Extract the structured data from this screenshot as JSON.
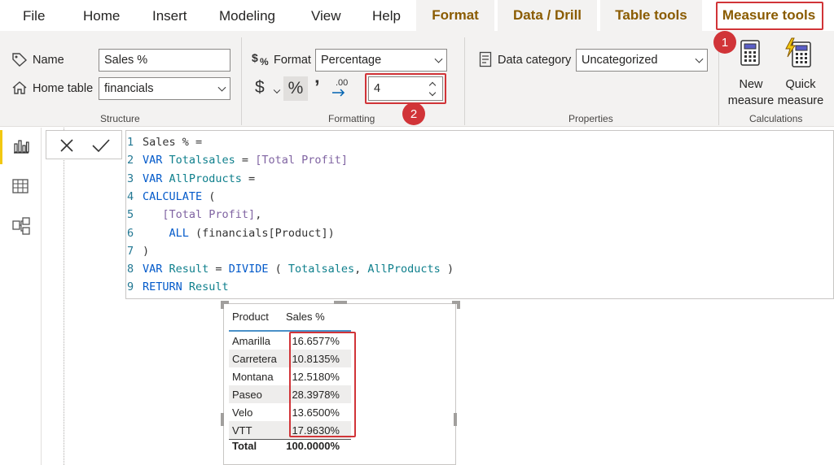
{
  "menu": {
    "file": "File",
    "home": "Home",
    "insert": "Insert",
    "modeling": "Modeling",
    "view": "View",
    "help": "Help",
    "format": "Format",
    "data_drill": "Data / Drill",
    "table_tools": "Table tools",
    "measure_tools": "Measure tools"
  },
  "structure": {
    "name_label": "Name",
    "name_value": "Sales %",
    "home_table_label": "Home table",
    "home_table_value": "financials",
    "group_label": "Structure"
  },
  "formatting": {
    "format_label": "Format",
    "format_value": "Percentage",
    "currency_symbol": "$",
    "percent_symbol": "%",
    "comma_symbol": "’",
    "decimal_symbol": ".00",
    "decimal_places": "4",
    "group_label": "Formatting"
  },
  "properties": {
    "data_category_label": "Data category",
    "data_category_value": "Uncategorized",
    "group_label": "Properties"
  },
  "calculations": {
    "new_measure": [
      "New",
      "measure"
    ],
    "quick_measure": [
      "Quick",
      "measure"
    ],
    "group_label": "Calculations"
  },
  "badges": {
    "one": "1",
    "two": "2"
  },
  "formula": {
    "lines": [
      {
        "n": "1",
        "parts": [
          {
            "t": "Sales % =",
            "c": "pl"
          }
        ]
      },
      {
        "n": "2",
        "parts": [
          {
            "t": "VAR ",
            "c": "kw"
          },
          {
            "t": "Totalsales",
            "c": "vr"
          },
          {
            "t": " = ",
            "c": "pl"
          },
          {
            "t": "[Total Profit]",
            "c": "ms"
          }
        ]
      },
      {
        "n": "3",
        "parts": [
          {
            "t": "VAR ",
            "c": "kw"
          },
          {
            "t": "AllProducts",
            "c": "vr"
          },
          {
            "t": " =",
            "c": "pl"
          }
        ]
      },
      {
        "n": "4",
        "parts": [
          {
            "t": "CALCULATE",
            "c": "kw"
          },
          {
            "t": " (",
            "c": "pl"
          }
        ]
      },
      {
        "n": "5",
        "parts": [
          {
            "t": "   ",
            "c": "pl"
          },
          {
            "t": "[Total Profit]",
            "c": "ms"
          },
          {
            "t": ",",
            "c": "pl"
          }
        ]
      },
      {
        "n": "6",
        "parts": [
          {
            "t": "    ",
            "c": "pl"
          },
          {
            "t": "ALL",
            "c": "kw"
          },
          {
            "t": " (",
            "c": "pl"
          },
          {
            "t": "financials[Product]",
            "c": "tb"
          },
          {
            "t": ")",
            "c": "pl"
          }
        ]
      },
      {
        "n": "7",
        "parts": [
          {
            "t": ")",
            "c": "pl"
          }
        ]
      },
      {
        "n": "8",
        "parts": [
          {
            "t": "VAR ",
            "c": "kw"
          },
          {
            "t": "Result",
            "c": "vr"
          },
          {
            "t": " = ",
            "c": "pl"
          },
          {
            "t": "DIVIDE",
            "c": "kw"
          },
          {
            "t": " ( ",
            "c": "pl"
          },
          {
            "t": "Totalsales",
            "c": "vr"
          },
          {
            "t": ", ",
            "c": "pl"
          },
          {
            "t": "AllProducts",
            "c": "vr"
          },
          {
            "t": " )",
            "c": "pl"
          }
        ]
      },
      {
        "n": "9",
        "parts": [
          {
            "t": "RETURN ",
            "c": "kw"
          },
          {
            "t": "Result",
            "c": "vr"
          }
        ]
      }
    ]
  },
  "table": {
    "headers": [
      "Product",
      "Sales %"
    ],
    "rows": [
      [
        "Amarilla",
        "16.6577%"
      ],
      [
        "Carretera",
        "10.8135%"
      ],
      [
        "Montana",
        "12.5180%"
      ],
      [
        "Paseo",
        "28.3978%"
      ],
      [
        "Velo",
        "13.6500%"
      ],
      [
        "VTT",
        "17.9630%"
      ]
    ],
    "total": [
      "Total",
      "100.0000%"
    ]
  },
  "colors": {
    "accent_yellow": "#f2c811",
    "context_tab_text": "#8a5b00",
    "highlight_red": "#d13438",
    "keyword_blue": "#035aca",
    "variable_teal": "#0e7f8c",
    "measure_purple": "#8064a2"
  },
  "icons": {
    "name": "tag-icon",
    "home_table": "home-icon",
    "format": "dollar-percent-icon",
    "data_category": "data-category-icon",
    "new_measure": "calculator-icon",
    "quick_measure": "lightning-calculator-icon",
    "report_view": "bar-chart-icon",
    "data_view": "table-grid-icon",
    "model_view": "model-icon",
    "cancel": "close-icon",
    "commit": "check-icon"
  }
}
